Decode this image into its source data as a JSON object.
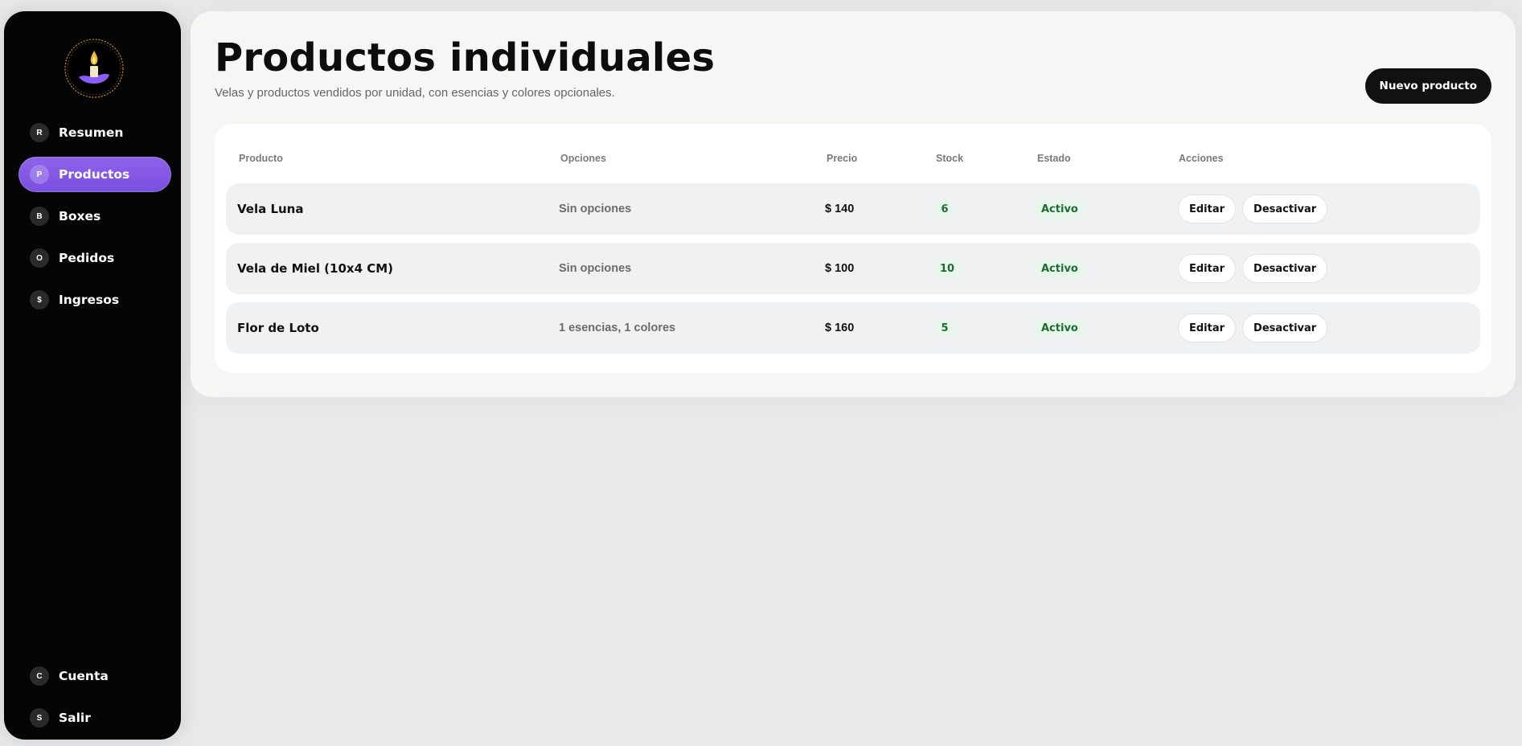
{
  "sidebar": {
    "logo_icon": "candle-hand-logo",
    "items": [
      {
        "badge": "R",
        "label": "Resumen",
        "active": false
      },
      {
        "badge": "P",
        "label": "Productos",
        "active": true
      },
      {
        "badge": "B",
        "label": "Boxes",
        "active": false
      },
      {
        "badge": "O",
        "label": "Pedidos",
        "active": false
      },
      {
        "badge": "$",
        "label": "Ingresos",
        "active": false
      }
    ],
    "bottom_items": [
      {
        "badge": "C",
        "label": "Cuenta"
      },
      {
        "badge": "S",
        "label": "Salir"
      }
    ],
    "accent_color": "#8b5cf6"
  },
  "header": {
    "title": "Productos individuales",
    "subtitle": "Velas y productos vendidos por unidad, con esencias y colores opcionales.",
    "new_button_label": "Nuevo producto"
  },
  "table": {
    "columns": [
      "Producto",
      "Opciones",
      "Precio",
      "Stock",
      "Estado",
      "Acciones"
    ],
    "rows": [
      {
        "name": "Vela Luna",
        "options": "Sin opciones",
        "price": "$ 140",
        "stock": "6",
        "status": "Activo",
        "edit": "Editar",
        "deactivate": "Desactivar"
      },
      {
        "name": "Vela de Miel (10x4 CM)",
        "options": "Sin opciones",
        "price": "$ 100",
        "stock": "10",
        "status": "Activo",
        "edit": "Editar",
        "deactivate": "Desactivar"
      },
      {
        "name": "Flor de Loto",
        "options": "1 esencias, 1 colores",
        "price": "$ 160",
        "stock": "5",
        "status": "Activo",
        "edit": "Editar",
        "deactivate": "Desactivar"
      }
    ],
    "status_color": "#1f6b34"
  }
}
